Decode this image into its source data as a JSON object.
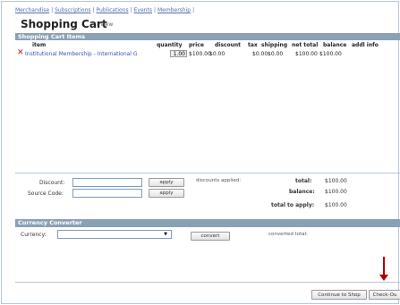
{
  "nav": {
    "items": [
      "Merchandise",
      "Subscriptions",
      "Publications",
      "Events",
      "Membership"
    ],
    "separator": "|"
  },
  "page": {
    "title": "Shopping Cart",
    "separator": "|",
    "subtitle": "View"
  },
  "cart": {
    "section_title": "Shopping Cart Items",
    "columns": {
      "item": "item",
      "quantity": "quantity",
      "price": "price",
      "discount": "discount",
      "tax": "tax",
      "shipping": "shipping",
      "net_total": "net total",
      "balance": "balance",
      "addl_info": "addl info"
    },
    "rows": [
      {
        "remove_icon": "x-icon",
        "item": "Institutional Membership - International G",
        "quantity": "1.00",
        "price": "$100.00",
        "discount": "$0.00",
        "tax": "$0.00",
        "shipping": "$0.00",
        "net_total": "$100.00",
        "balance": "$100.00"
      }
    ]
  },
  "discounts": {
    "discount_label": "Discount:",
    "source_code_label": "Source Code:",
    "apply_label": "apply",
    "applied_label": "discounts applied:",
    "total_label": "total:",
    "total_value": "$100.00",
    "balance_label": "balance:",
    "balance_value": "$100.00",
    "total_to_apply_label": "total to apply:",
    "total_to_apply_value": "$100.00"
  },
  "currency": {
    "section_title": "Currency Converter",
    "currency_label": "Currency:",
    "select_value": "",
    "convert_label": "convert",
    "converted_total_label": "converted total:"
  },
  "footer": {
    "continue_label": "Continue to Shop",
    "checkout_label": "Check-Ou"
  },
  "colors": {
    "section_header": "#8aa1b5",
    "link": "#4d6eb0",
    "remove": "#d01010",
    "arrow": "#b00000"
  }
}
